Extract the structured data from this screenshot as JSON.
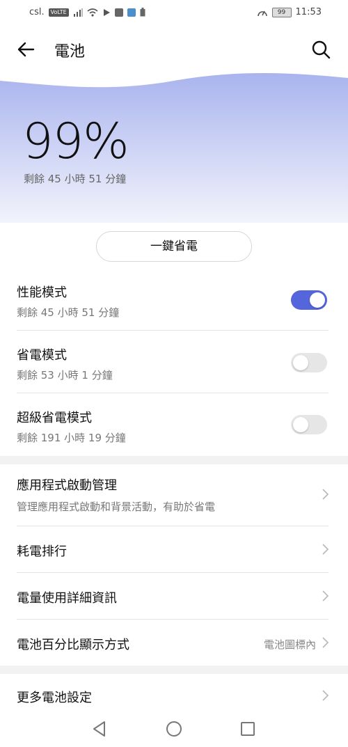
{
  "status_bar": {
    "carrier": "csl.",
    "network_chip": "VoLTE",
    "battery_level": "99",
    "time": "11:53"
  },
  "app_bar": {
    "title": "電池",
    "back_icon": "arrow-left-icon",
    "search_icon": "search-icon"
  },
  "hero": {
    "percent": "99%",
    "remaining": "剩餘 45 小時 51 分鐘",
    "gradient_top": "#a9b4ee",
    "gradient_bottom": "#f2f3fc"
  },
  "one_key_button": "一鍵省電",
  "modes": [
    {
      "title": "性能模式",
      "remaining": "剩餘 45 小時 51 分鐘",
      "enabled": true
    },
    {
      "title": "省電模式",
      "remaining": "剩餘 53 小時 1 分鐘",
      "enabled": false
    },
    {
      "title": "超級省電模式",
      "remaining": "剩餘 191 小時 19 分鐘",
      "enabled": false
    }
  ],
  "settings": [
    {
      "title": "應用程式啟動管理",
      "subtitle": "管理應用程式啟動和背景活動，有助於省電"
    },
    {
      "title": "耗電排行"
    },
    {
      "title": "電量使用詳細資訊"
    },
    {
      "title": "電池百分比顯示方式",
      "value": "電池圖標內"
    }
  ],
  "more": {
    "title": "更多電池設定"
  },
  "colors": {
    "accent": "#5566dd",
    "switch_off": "#e6e6e6"
  },
  "nav_bar": {
    "back": "triangle-back-icon",
    "home": "circle-home-icon",
    "recents": "square-recents-icon"
  }
}
